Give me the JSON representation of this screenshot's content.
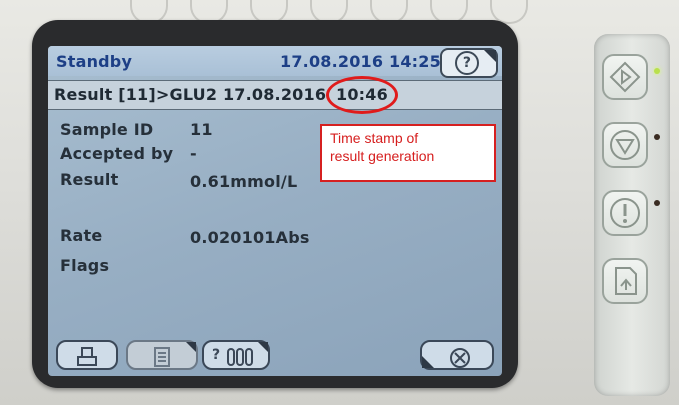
{
  "status_bar": {
    "mode": "Standby",
    "datetime": "17.08.2016 14:25",
    "help_label": "?"
  },
  "result_bar": {
    "title": "Result [11]>GLU2  17.08.2016",
    "time": "10:46"
  },
  "fields": [
    {
      "label": "Sample ID",
      "value": "11"
    },
    {
      "label": "Accepted by",
      "value": "-"
    },
    {
      "label": "Result",
      "value": "0.61mmol/L"
    },
    {
      "label": "Rate",
      "value": "0.020101Abs"
    },
    {
      "label": "Flags",
      "value": ""
    }
  ],
  "callout": {
    "line1": "Time stamp of",
    "line2": "result generation",
    "color": "#d61e1e"
  },
  "bottom_buttons": [
    {
      "icon": "print-icon"
    },
    {
      "icon": "document-icon"
    },
    {
      "icon": "tube-rack-icon",
      "label": "?"
    },
    {
      "icon": "cancel-icon"
    }
  ],
  "side_panel": [
    {
      "icon": "start-icon",
      "led": "on"
    },
    {
      "icon": "stop-icon",
      "led": "off"
    },
    {
      "icon": "alert-icon",
      "led": "off"
    },
    {
      "icon": "report-icon"
    }
  ],
  "colors": {
    "screen": "#97aec3",
    "status_text": "#1d3f86",
    "annotation": "#e01b1b"
  }
}
